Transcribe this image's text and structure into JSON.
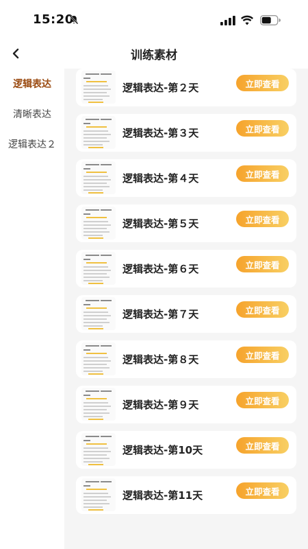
{
  "status_bar": {
    "time": "15:20"
  },
  "header": {
    "title": "训练素材"
  },
  "sidebar": {
    "items": [
      {
        "label": "逻辑表达",
        "active": true
      },
      {
        "label": "清晰表达",
        "active": false
      },
      {
        "label": "逻辑表达２",
        "active": false
      }
    ]
  },
  "list": {
    "button_label": "立即查看",
    "items": [
      {
        "title": "逻辑表达-第２天"
      },
      {
        "title": "逻辑表达-第３天"
      },
      {
        "title": "逻辑表达-第４天"
      },
      {
        "title": "逻辑表达-第５天"
      },
      {
        "title": "逻辑表达-第６天"
      },
      {
        "title": "逻辑表达-第７天"
      },
      {
        "title": "逻辑表达-第８天"
      },
      {
        "title": "逻辑表达-第９天"
      },
      {
        "title": "逻辑表达-第10天"
      },
      {
        "title": "逻辑表达-第11天"
      }
    ]
  },
  "colors": {
    "accent_start": "#f6a32c",
    "accent_end": "#f8cf63",
    "active_tab": "#9a4a10"
  }
}
